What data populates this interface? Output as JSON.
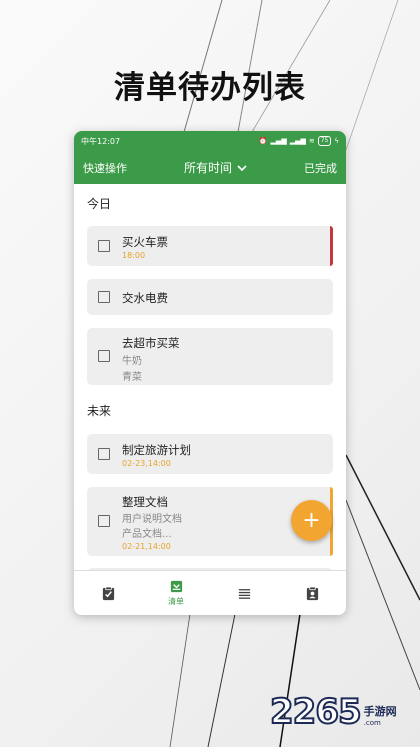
{
  "headline": "清单待办列表",
  "status_bar": {
    "time": "中午12:07",
    "battery": "75"
  },
  "toolbar": {
    "left_label": "快速操作",
    "filter_label": "所有时间",
    "right_label": "已完成"
  },
  "sections": [
    {
      "title": "今日"
    },
    {
      "title": "未来"
    }
  ],
  "tasks": [
    {
      "title": "买火车票",
      "time": "18:00",
      "accent": "#c8363a"
    },
    {
      "title": "交水电费"
    },
    {
      "title": "去超市买菜",
      "sub1": "牛奶",
      "sub2": "青菜"
    },
    {
      "title": "制定旅游计划",
      "time": "02-23,14:00"
    },
    {
      "title": "整理文档",
      "sub1": "用户说明文档",
      "sub2": "产品文档...",
      "time": "02-21,14:00",
      "accent": "#f3a532"
    }
  ],
  "fab": {
    "label": "+"
  },
  "bottom_nav": {
    "active_label": "清单"
  },
  "watermark": {
    "number": "2265",
    "cn": "手游网",
    "en": ".com"
  },
  "colors": {
    "primary": "#3c9b48",
    "accent": "#f3a532",
    "urgent": "#c8363a",
    "time": "#e8a32c"
  }
}
